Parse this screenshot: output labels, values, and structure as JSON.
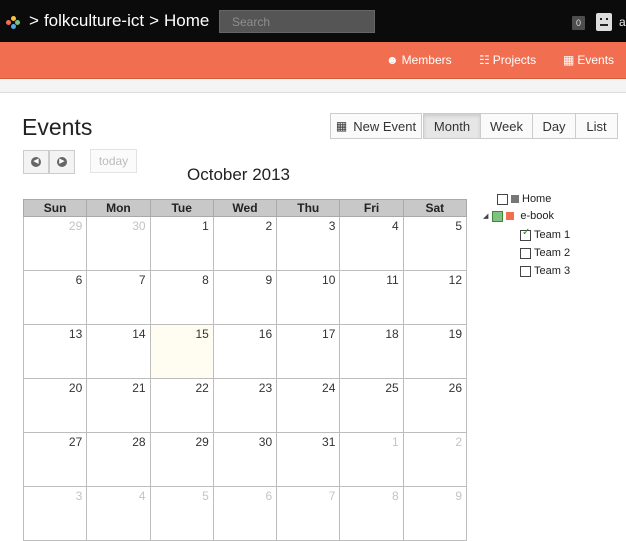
{
  "colors": {
    "accent": "#f16f50",
    "topbar": "#0b0b0b",
    "home_color": "#777777",
    "ebook_color": "#f16f50"
  },
  "topbar": {
    "breadcrumb": [
      "folkculture-ict",
      "Home"
    ],
    "breadcrumb_separator": ">",
    "search_placeholder": "Search",
    "notification_count": "0",
    "user_initial_cutoff": "a"
  },
  "navbar": {
    "items": [
      {
        "label": "Members",
        "icon": "users-icon"
      },
      {
        "label": "Projects",
        "icon": "sitemap-icon"
      },
      {
        "label": "Events",
        "icon": "calendar-icon"
      }
    ]
  },
  "page": {
    "title": "Events"
  },
  "toolbar": {
    "new_event_label": "New Event",
    "views": [
      "Month",
      "Week",
      "Day",
      "List"
    ],
    "active_view": "Month",
    "today_label": "today",
    "prev_icon": "chevron-left-icon",
    "next_icon": "chevron-right-icon"
  },
  "calendar": {
    "month_title": "October 2013",
    "weekdays": [
      "Sun",
      "Mon",
      "Tue",
      "Wed",
      "Thu",
      "Fri",
      "Sat"
    ],
    "today": "15",
    "weeks": [
      [
        "29",
        "30",
        "1",
        "2",
        "3",
        "4",
        "5"
      ],
      [
        "6",
        "7",
        "8",
        "9",
        "10",
        "11",
        "12"
      ],
      [
        "13",
        "14",
        "15",
        "16",
        "17",
        "18",
        "19"
      ],
      [
        "20",
        "21",
        "22",
        "23",
        "24",
        "25",
        "26"
      ],
      [
        "27",
        "28",
        "29",
        "30",
        "31",
        "1",
        "2"
      ],
      [
        "3",
        "4",
        "5",
        "6",
        "7",
        "8",
        "9"
      ]
    ],
    "other_month_cells": [
      [
        0,
        0
      ],
      [
        0,
        1
      ],
      [
        4,
        5
      ],
      [
        4,
        6
      ],
      [
        5,
        0
      ],
      [
        5,
        1
      ],
      [
        5,
        2
      ],
      [
        5,
        3
      ],
      [
        5,
        4
      ],
      [
        5,
        5
      ],
      [
        5,
        6
      ]
    ]
  },
  "calendars_tree": {
    "home_label": "Home",
    "ebook_label": "e-book",
    "teams": [
      {
        "label": "Team 1",
        "checked": true
      },
      {
        "label": "Team 2",
        "checked": false
      },
      {
        "label": "Team 3",
        "checked": false
      }
    ]
  }
}
